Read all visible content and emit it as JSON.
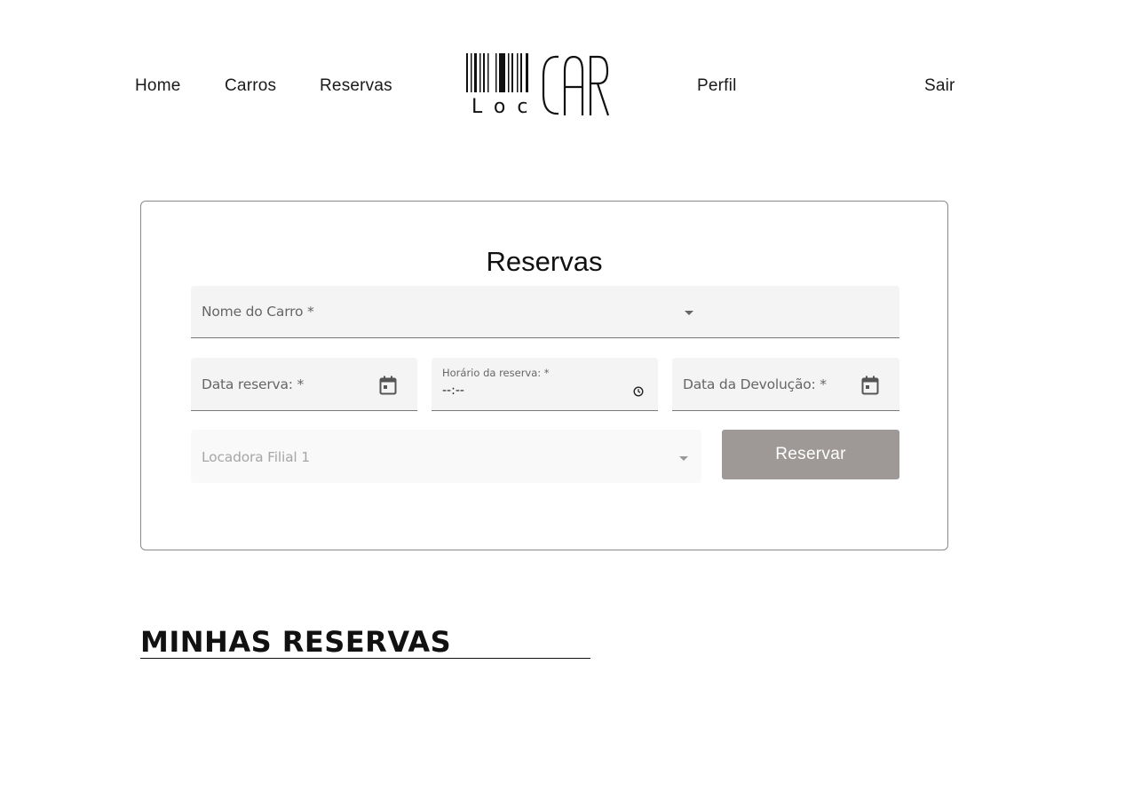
{
  "nav": {
    "home": "Home",
    "cars": "Carros",
    "reservations": "Reservas",
    "profile": "Perfil",
    "logout": "Sair"
  },
  "logo": {
    "text_loc": "Loc",
    "text_car": "CAR",
    "icon": "barcode-icon"
  },
  "form": {
    "title": "Reservas",
    "car_name_label": "Nome do Carro *",
    "reservation_date_label": "Data reserva: *",
    "reservation_time_label": "Horário da reserva: *",
    "reservation_time_value": "--:--",
    "return_date_label": "Data da Devolução: *",
    "branch_value": "Locadora Filial 1",
    "submit_label": "Reservar",
    "colors": {
      "button_bg": "#9e9896",
      "field_bg": "#f4f4f4"
    }
  },
  "section": {
    "my_reservations_title": "MINHAS RESERVAS"
  }
}
